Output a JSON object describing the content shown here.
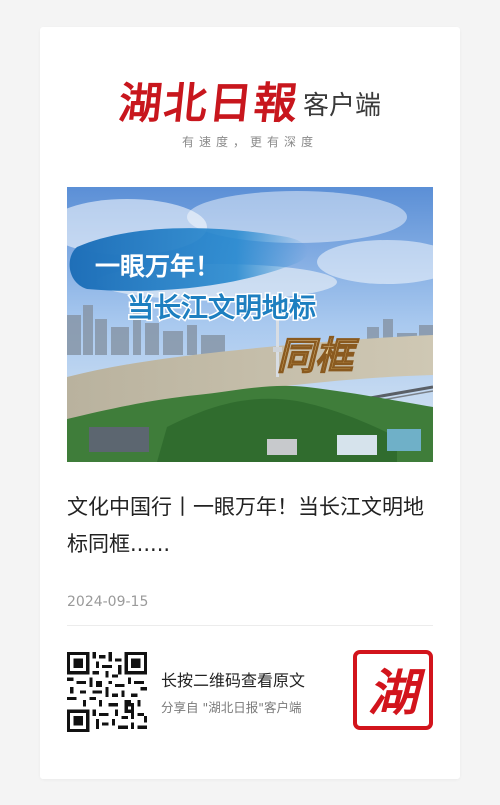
{
  "header": {
    "brand": "湖北日報",
    "brand_suffix": "客户端",
    "slogan": "有速度，更有深度"
  },
  "hero": {
    "line1": "一眼万年！",
    "line2": "当长江文明地标",
    "line3": "同框"
  },
  "article": {
    "title": "文化中国行丨一眼万年！当长江文明地标同框......",
    "date": "2024-09-15"
  },
  "share": {
    "title": "长按二维码查看原文",
    "subtitle": "分享自 \"湖北日报\"客户端",
    "seal_char": "湖"
  },
  "colors": {
    "brand_red": "#c8161d",
    "background": "#f4f4f4"
  }
}
